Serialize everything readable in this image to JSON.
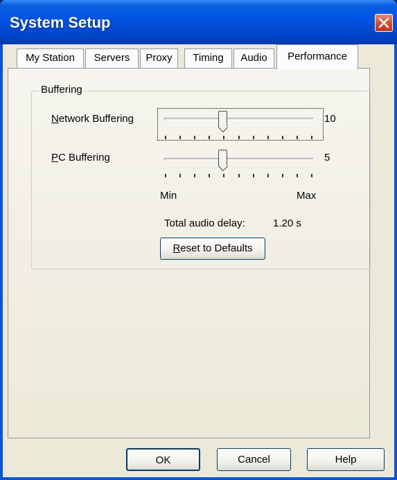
{
  "window": {
    "title": "System Setup"
  },
  "tabs": [
    {
      "label": "My Station",
      "active": false
    },
    {
      "label": "Servers",
      "active": false
    },
    {
      "label": "Proxy",
      "active": false
    },
    {
      "label": "Timing",
      "active": false
    },
    {
      "label": "Audio",
      "active": false
    },
    {
      "label": "Performance",
      "active": true
    }
  ],
  "buffering": {
    "group_label": "Buffering",
    "network": {
      "label_access": "N",
      "label_rest": "etwork Buffering",
      "value": "10"
    },
    "pc": {
      "label_access": "P",
      "label_rest": "C Buffering",
      "value": "5"
    },
    "scale_min": "Min",
    "scale_max": "Max",
    "delay_label": "Total audio delay:",
    "delay_value": "1.20 s",
    "reset_access": "R",
    "reset_rest": "eset to Defaults"
  },
  "footer": {
    "ok": "OK",
    "cancel": "Cancel",
    "help": "Help"
  },
  "colors": {
    "titlebar": "#0055e5",
    "client": "#ece9d8",
    "close_button": "#d6452a"
  }
}
